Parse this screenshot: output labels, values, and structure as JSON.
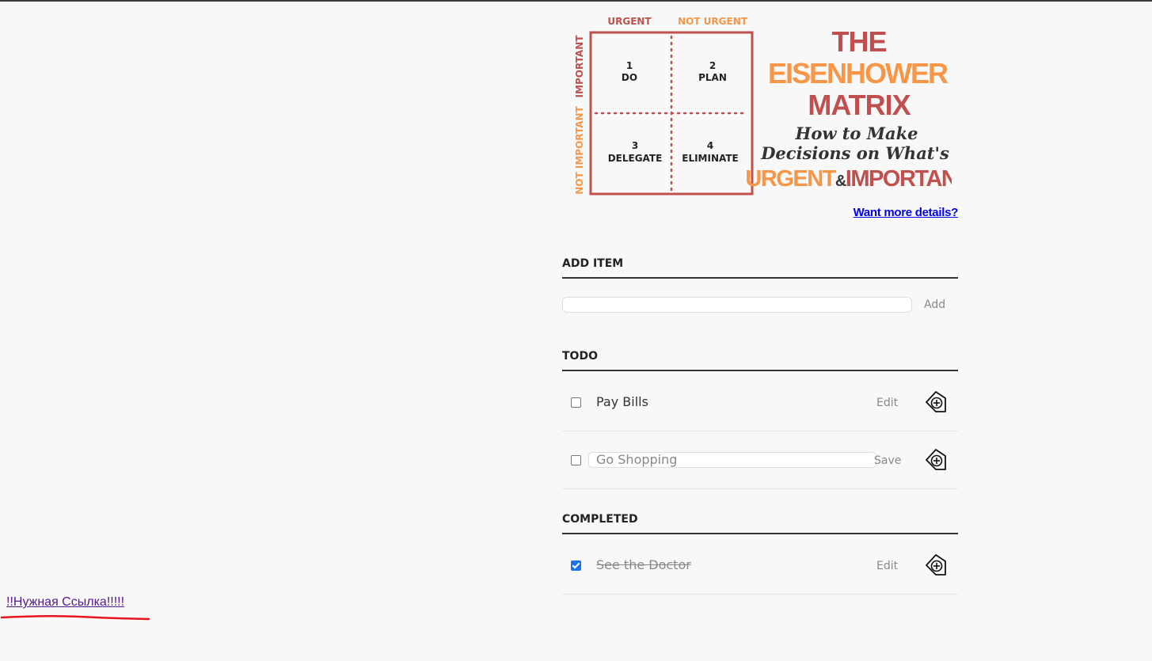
{
  "colors": {
    "matrix_red": "#c0504d",
    "matrix_orange": "#f79646",
    "link_blue": "#0000ee",
    "visited_link": "#551a8b",
    "annotation_red": "#e8141c",
    "checkbox_blue": "#1a73e8"
  },
  "matrix": {
    "col_urgent": "URGENT",
    "col_not_urgent": "NOT URGENT",
    "row_important": "IMPORTANT",
    "row_not_important": "NOT IMPORTANT",
    "q1_number": "1",
    "q1_label": "DO",
    "q2_number": "2",
    "q2_label": "PLAN",
    "q3_number": "3",
    "q3_label": "DELEGATE",
    "q4_number": "4",
    "q4_label": "ELIMINATE",
    "title_line1": "THE",
    "title_line2": "EISENHOWER",
    "title_line3": "MATRIX",
    "subtitle_line1": "How to Make",
    "subtitle_line2": "Decisions on What's",
    "tag_urgent": "URGENT",
    "tag_amp": "&",
    "tag_important": "IMPORTANT"
  },
  "details_link": "Want more details?",
  "add_section": {
    "heading": "ADD ITEM",
    "input_value": "",
    "button_label": "Add"
  },
  "todo_section": {
    "heading": "TODO",
    "items": [
      {
        "label": "Pay Bills",
        "checked": false,
        "action": "Edit",
        "icon": "tag-plus-icon"
      },
      {
        "label": "Go Shopping",
        "checked": false,
        "editing": true,
        "action": "Save",
        "icon": "tag-plus-icon"
      }
    ]
  },
  "completed_section": {
    "heading": "COMPLETED",
    "items": [
      {
        "label": "See the Doctor",
        "checked": true,
        "action": "Edit",
        "icon": "tag-plus-icon"
      }
    ]
  },
  "magic_link": "!!Нужная Ссылка!!!!!"
}
